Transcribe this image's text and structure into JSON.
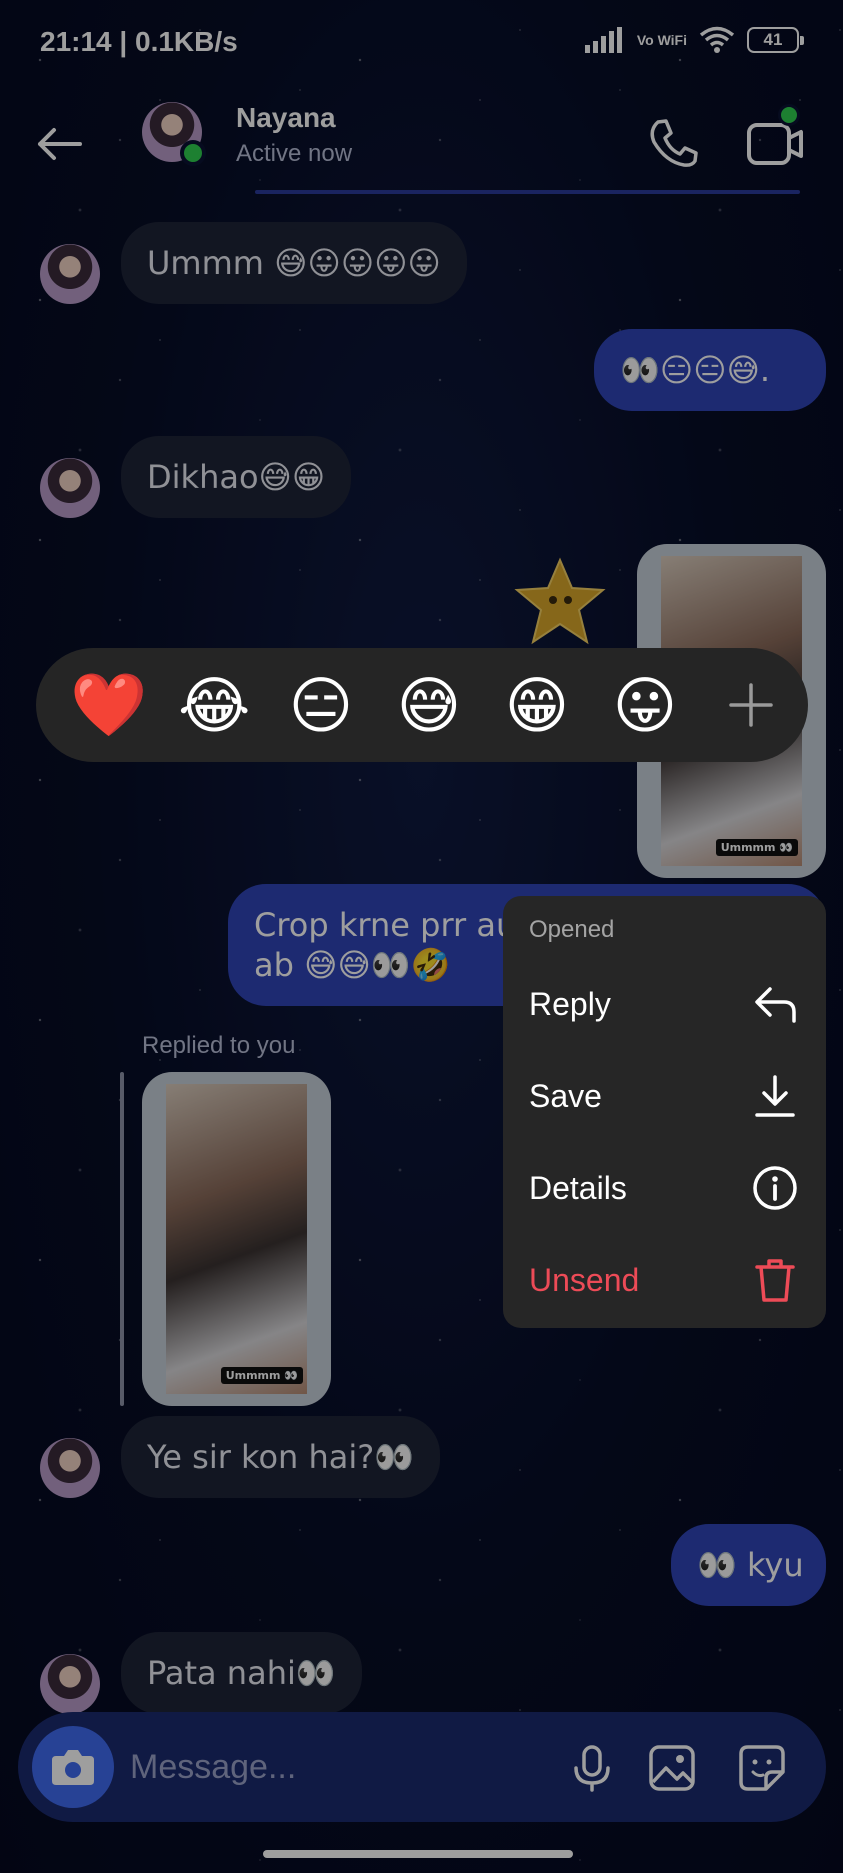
{
  "status_bar": {
    "time": "21:14 | 0.1KB/s",
    "network_label": "Vo WiFi",
    "battery": "41"
  },
  "header": {
    "name": "Nayana",
    "status": "Active now"
  },
  "messages": {
    "m1": "Ummm 😅😛😛😛😛",
    "m2": "👀😑😑😅.",
    "m3": "Dikhao😅😁",
    "media_tag": "Ummmm 👀",
    "m4_line1": "Crop krne prr aur",
    "m4_line2": "ab  😅😅👀🤣",
    "replied_label": "Replied to you",
    "m5": "Ye sir kon hai?👀",
    "m6": "👀 kyu",
    "m7": "Pata nahi👀"
  },
  "reactions": [
    "❤️",
    "😂",
    "😑",
    "😅",
    "😁",
    "😛"
  ],
  "context_menu": {
    "header": "Opened",
    "items": [
      {
        "label": "Reply",
        "icon": "reply-icon"
      },
      {
        "label": "Save",
        "icon": "download-icon"
      },
      {
        "label": "Details",
        "icon": "info-icon"
      },
      {
        "label": "Unsend",
        "icon": "trash-icon"
      }
    ]
  },
  "composer": {
    "placeholder": "Message..."
  },
  "colors": {
    "accent": "#3f6bf0",
    "outgoing": "#2f44b7",
    "incoming": "#1e2438",
    "danger": "#ed4b57",
    "online": "#2fcf4f"
  }
}
